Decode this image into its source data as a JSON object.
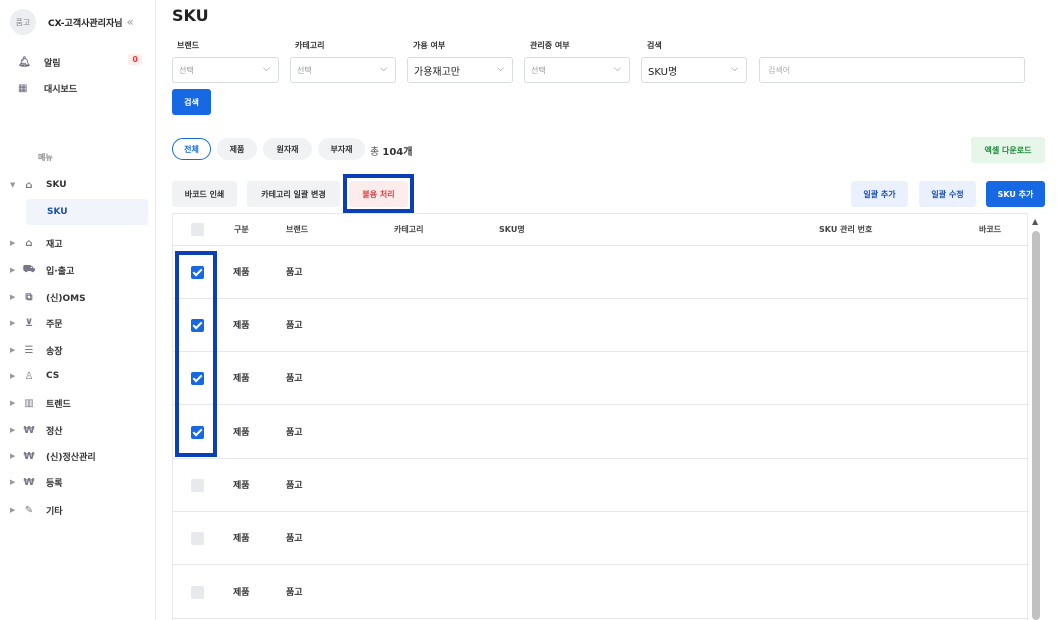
{
  "sidebar": {
    "avatar_text": "품고",
    "user_name": "CX-고객사관리자님",
    "collapse_icon": "«",
    "top_items": [
      {
        "label": "알림",
        "icon": "bell-icon",
        "badge": "0"
      },
      {
        "label": "대시보드",
        "icon": "dashboard-icon"
      }
    ],
    "menu_heading": "메뉴",
    "nav": [
      {
        "label": "SKU",
        "icon": "bag-icon",
        "expanded": true
      },
      {
        "label": "재고",
        "icon": "warehouse-icon"
      },
      {
        "label": "입·출고",
        "icon": "truck-icon"
      },
      {
        "label": "(신)OMS",
        "icon": "oms-icon"
      },
      {
        "label": "주문",
        "icon": "cart-icon"
      },
      {
        "label": "송장",
        "icon": "invoice-icon"
      },
      {
        "label": "CS",
        "icon": "person-icon"
      },
      {
        "label": "트렌드",
        "icon": "bar-chart-icon"
      },
      {
        "label": "정산",
        "icon": "won-icon"
      },
      {
        "label": "(신)정산관리",
        "icon": "won-icon"
      },
      {
        "label": "등록",
        "icon": "won-icon"
      },
      {
        "label": "기타",
        "icon": "pencil-icon"
      }
    ],
    "sub_item": "SKU"
  },
  "page": {
    "title": "SKU"
  },
  "filters": {
    "brand": {
      "label": "브랜드",
      "value": "선택"
    },
    "category": {
      "label": "카테고리",
      "value": "선택"
    },
    "availability": {
      "label": "가용 여부",
      "value": "가용재고만"
    },
    "managed": {
      "label": "관리중 여부",
      "value": "선택"
    },
    "search_type": {
      "label": "검색",
      "value": "SKU명"
    },
    "search_placeholder": "검색어",
    "search_button": "검색"
  },
  "chips": [
    {
      "label": "전체",
      "active": true
    },
    {
      "label": "제품"
    },
    {
      "label": "원자재"
    },
    {
      "label": "부자재"
    }
  ],
  "total": {
    "prefix": "총",
    "count": "104개"
  },
  "excel_button": "엑셀 다운로드",
  "actions": {
    "barcode_print": "바코드 인쇄",
    "category_bulk": "카테고리 일괄 변경",
    "disable": "불용 처리",
    "bulk_add": "일괄 추가",
    "bulk_edit": "일괄 수정",
    "sku_add": "SKU 추가"
  },
  "table": {
    "headers": {
      "type": "구분",
      "brand": "브랜드",
      "category": "카테고리",
      "sku_name": "SKU명",
      "sku_code": "SKU 관리 번호",
      "barcode": "바코드"
    },
    "rows": [
      {
        "type": "제품",
        "brand": "품고",
        "checked": true
      },
      {
        "type": "제품",
        "brand": "품고",
        "checked": true
      },
      {
        "type": "제품",
        "brand": "품고",
        "checked": true
      },
      {
        "type": "제품",
        "brand": "품고",
        "checked": true
      },
      {
        "type": "제품",
        "brand": "품고",
        "checked": false
      },
      {
        "type": "제품",
        "brand": "품고",
        "checked": false
      },
      {
        "type": "제품",
        "brand": "품고",
        "checked": false
      }
    ]
  },
  "colors": {
    "primary": "#1668e3",
    "highlight": "#0b3fb8",
    "danger": "#e04040",
    "success": "#1f8a3b"
  }
}
